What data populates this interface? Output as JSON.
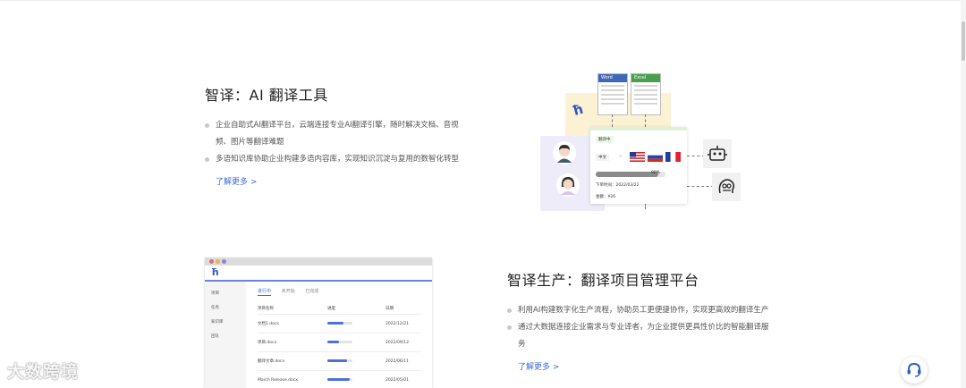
{
  "section1": {
    "title": "智译：AI 翻译工具",
    "bullets": [
      "企业自助式AI翻译平台，云端连接专业AI翻译引擎，随时解决文档、音视频、图片等翻译难题",
      "多语知识库协助企业构建多语内容库，实现知识沉淀与复用的数智化转型"
    ],
    "more": "了解更多 >"
  },
  "illustration1": {
    "word_label": "Word",
    "excel_label": "Excel",
    "status": "翻译中",
    "source_lang": "中文",
    "arrow": ">",
    "progress_text": "90%",
    "progress": 0.9,
    "order_time": "下单时间：2022/03/22",
    "amount": "金额：¥26"
  },
  "section2": {
    "title": "智译生产：翻译项目管理平台",
    "bullets": [
      "利用AI构建数字化生产流程，协助员工更便捷协作，实现更高效的翻译生产",
      "通过大数据连接企业需求与专业译者，为企业提供更具性价比的智能翻译服务"
    ],
    "more": "了解更多 >"
  },
  "mockup": {
    "logo": "ħ",
    "sidebar": [
      "项目",
      "任务",
      "知识库",
      "团队"
    ],
    "tabs": [
      "进行中",
      "未开始",
      "已完成"
    ],
    "columns": [
      "项目名称",
      "进度",
      "日期"
    ],
    "rows": [
      {
        "name": "文档1.docx",
        "progress": 0.65,
        "date": "2022/12/21"
      },
      {
        "name": "项目.docx",
        "progress": 0.45,
        "date": "2022/09/12"
      },
      {
        "name": "翻译文章.docx",
        "progress": 0.8,
        "date": "2022/06/11"
      },
      {
        "name": "March Release.docx",
        "progress": 0.9,
        "date": "2022/05/01"
      }
    ]
  },
  "watermark": "大数跨境",
  "colors": {
    "accent": "#3d6bd9",
    "progress_bar": "#4b6fdc",
    "yellow_bg": "#fbf1d3",
    "lavender_bg": "#eeecf8"
  },
  "icons": {
    "support": "headset-icon",
    "logo": "zhiyi-logo-icon"
  }
}
